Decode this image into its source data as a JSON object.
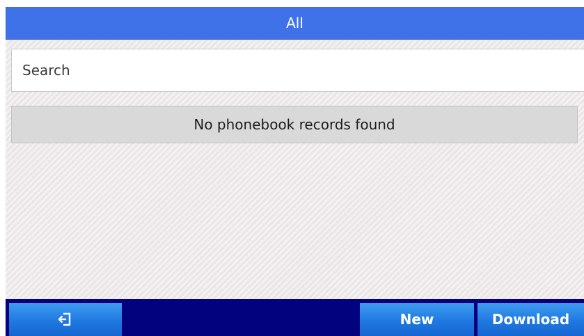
{
  "header": {
    "title": "All"
  },
  "search": {
    "placeholder": "Search",
    "value": ""
  },
  "phonebook": {
    "empty_message": "No phonebook records found"
  },
  "softkeys": {
    "back_icon": "exit-icon",
    "new_label": "New",
    "download_label": "Download"
  },
  "colors": {
    "title_bar": "#3f72e8",
    "softkey_bar": "#02027e",
    "softkey": "#1f78e0",
    "background": "#ebe7e9"
  }
}
